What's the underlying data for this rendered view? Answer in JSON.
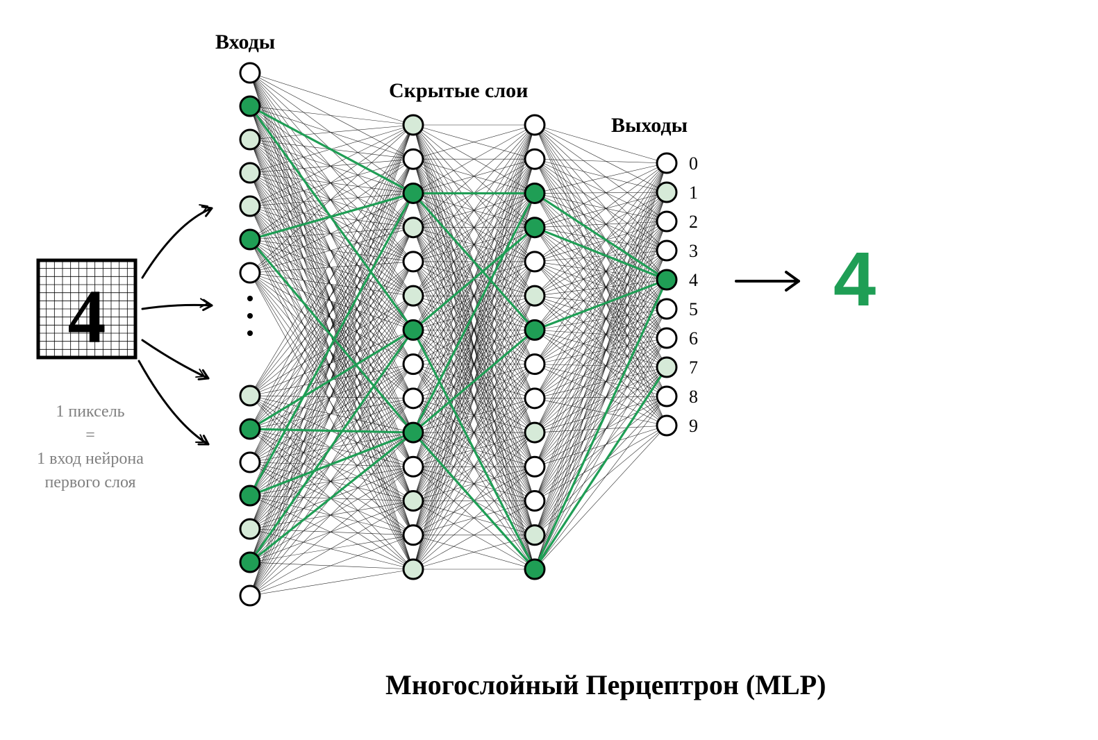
{
  "labels": {
    "inputs": "Входы",
    "hidden": "Скрытые слои",
    "outputs": "Выходы",
    "pixel_note_l1": "1 пиксель",
    "pixel_note_l2": "=",
    "pixel_note_l3": "1 вход нейрона",
    "pixel_note_l4": "первого слоя",
    "title": "Многослойный Перцептрон (MLP)",
    "input_glyph": "4",
    "output_value": "4"
  },
  "output_digits": [
    "0",
    "1",
    "2",
    "3",
    "4",
    "5",
    "6",
    "7",
    "8",
    "9"
  ],
  "colors": {
    "stroke": "#000000",
    "light": "#d6ead8",
    "dark": "#1f9e55",
    "accent": "#1f9e55",
    "grey": "#808080"
  },
  "chart_data": {
    "type": "diagram",
    "title": "Многослойный Перцептрон (MLP)",
    "description": "Feed-forward fully-connected network classifying pixel image of digit '4' to output class 4.",
    "input_note": "1 пиксель = 1 вход нейрона первого слоя",
    "layers": [
      {
        "name": "input",
        "label": "Входы",
        "has_ellipsis": true,
        "nodes": [
          {
            "activation": 0.0
          },
          {
            "activation": 1.0
          },
          {
            "activation": 0.3
          },
          {
            "activation": 0.3
          },
          {
            "activation": 0.3
          },
          {
            "activation": 1.0
          },
          {
            "activation": 0.0
          },
          {
            "activation": 0.3
          },
          {
            "activation": 1.0
          },
          {
            "activation": 0.0
          },
          {
            "activation": 1.0
          },
          {
            "activation": 0.3
          },
          {
            "activation": 1.0
          },
          {
            "activation": 0.0
          }
        ]
      },
      {
        "name": "hidden1",
        "label": "Скрытые слои",
        "nodes": [
          {
            "activation": 0.3
          },
          {
            "activation": 0.0
          },
          {
            "activation": 1.0
          },
          {
            "activation": 0.3
          },
          {
            "activation": 0.0
          },
          {
            "activation": 0.3
          },
          {
            "activation": 1.0
          },
          {
            "activation": 0.0
          },
          {
            "activation": 0.0
          },
          {
            "activation": 1.0
          },
          {
            "activation": 0.0
          },
          {
            "activation": 0.3
          },
          {
            "activation": 0.0
          },
          {
            "activation": 0.3
          }
        ]
      },
      {
        "name": "hidden2",
        "label": "Скрытые слои",
        "nodes": [
          {
            "activation": 0.0
          },
          {
            "activation": 0.0
          },
          {
            "activation": 1.0
          },
          {
            "activation": 1.0
          },
          {
            "activation": 0.0
          },
          {
            "activation": 0.3
          },
          {
            "activation": 1.0
          },
          {
            "activation": 0.0
          },
          {
            "activation": 0.0
          },
          {
            "activation": 0.3
          },
          {
            "activation": 0.0
          },
          {
            "activation": 0.0
          },
          {
            "activation": 0.3
          },
          {
            "activation": 1.0
          }
        ]
      },
      {
        "name": "output",
        "label": "Выходы",
        "nodes": [
          {
            "digit": 0,
            "activation": 0.0
          },
          {
            "digit": 1,
            "activation": 0.3
          },
          {
            "digit": 2,
            "activation": 0.0
          },
          {
            "digit": 3,
            "activation": 0.0
          },
          {
            "digit": 4,
            "activation": 1.0
          },
          {
            "digit": 5,
            "activation": 0.0
          },
          {
            "digit": 6,
            "activation": 0.0
          },
          {
            "digit": 7,
            "activation": 0.3
          },
          {
            "digit": 8,
            "activation": 0.0
          },
          {
            "digit": 9,
            "activation": 0.0
          }
        ]
      }
    ],
    "highlighted_edges": [
      {
        "from_layer": "input",
        "from_idx": 1,
        "to_layer": "hidden1",
        "to_idx": 2
      },
      {
        "from_layer": "input",
        "from_idx": 1,
        "to_layer": "hidden1",
        "to_idx": 6
      },
      {
        "from_layer": "input",
        "from_idx": 5,
        "to_layer": "hidden1",
        "to_idx": 2
      },
      {
        "from_layer": "input",
        "from_idx": 5,
        "to_layer": "hidden1",
        "to_idx": 9
      },
      {
        "from_layer": "input",
        "from_idx": 8,
        "to_layer": "hidden1",
        "to_idx": 9
      },
      {
        "from_layer": "input",
        "from_idx": 8,
        "to_layer": "hidden1",
        "to_idx": 6
      },
      {
        "from_layer": "input",
        "from_idx": 10,
        "to_layer": "hidden1",
        "to_idx": 2
      },
      {
        "from_layer": "input",
        "from_idx": 10,
        "to_layer": "hidden1",
        "to_idx": 9
      },
      {
        "from_layer": "input",
        "from_idx": 12,
        "to_layer": "hidden1",
        "to_idx": 6
      },
      {
        "from_layer": "input",
        "from_idx": 12,
        "to_layer": "hidden1",
        "to_idx": 9
      },
      {
        "from_layer": "hidden1",
        "from_idx": 2,
        "to_layer": "hidden2",
        "to_idx": 2
      },
      {
        "from_layer": "hidden1",
        "from_idx": 2,
        "to_layer": "hidden2",
        "to_idx": 6
      },
      {
        "from_layer": "hidden1",
        "from_idx": 6,
        "to_layer": "hidden2",
        "to_idx": 3
      },
      {
        "from_layer": "hidden1",
        "from_idx": 6,
        "to_layer": "hidden2",
        "to_idx": 13
      },
      {
        "from_layer": "hidden1",
        "from_idx": 9,
        "to_layer": "hidden2",
        "to_idx": 2
      },
      {
        "from_layer": "hidden1",
        "from_idx": 9,
        "to_layer": "hidden2",
        "to_idx": 6
      },
      {
        "from_layer": "hidden1",
        "from_idx": 9,
        "to_layer": "hidden2",
        "to_idx": 13
      },
      {
        "from_layer": "hidden2",
        "from_idx": 2,
        "to_layer": "output",
        "to_idx": 4
      },
      {
        "from_layer": "hidden2",
        "from_idx": 3,
        "to_layer": "output",
        "to_idx": 4
      },
      {
        "from_layer": "hidden2",
        "from_idx": 6,
        "to_layer": "output",
        "to_idx": 4
      },
      {
        "from_layer": "hidden2",
        "from_idx": 13,
        "to_layer": "output",
        "to_idx": 7
      },
      {
        "from_layer": "hidden2",
        "from_idx": 13,
        "to_layer": "output",
        "to_idx": 4
      }
    ],
    "predicted_class": 4
  }
}
